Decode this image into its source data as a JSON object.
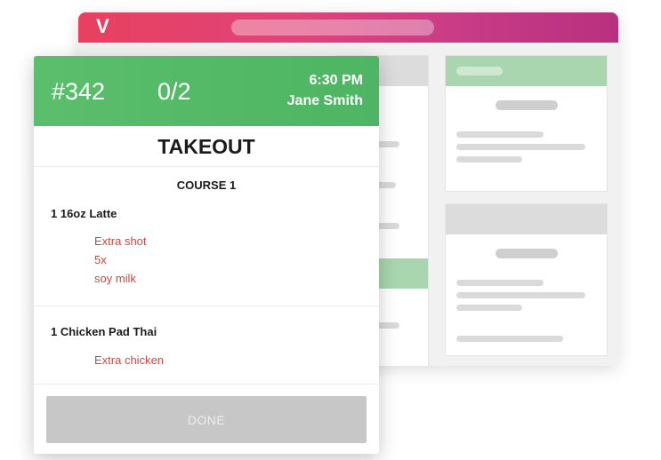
{
  "app": {
    "logo_text": "V"
  },
  "ticket": {
    "number": "#342",
    "progress": "0/2",
    "time": "6:30 PM",
    "customer": "Jane Smith",
    "order_type": "TAKEOUT",
    "course": "COURSE 1",
    "items": [
      {
        "name": "1 16oz Latte",
        "modifiers": [
          "Extra shot",
          "5x",
          "soy milk"
        ]
      },
      {
        "name": "1 Chicken Pad Thai",
        "modifiers": [
          "Extra chicken"
        ]
      }
    ],
    "done_label": "DONE"
  },
  "colors": {
    "header_green": "#4db563",
    "modifier_red": "#d0453f",
    "titlebar_pink": "#e0447a",
    "done_grey": "#c7c7c7"
  }
}
